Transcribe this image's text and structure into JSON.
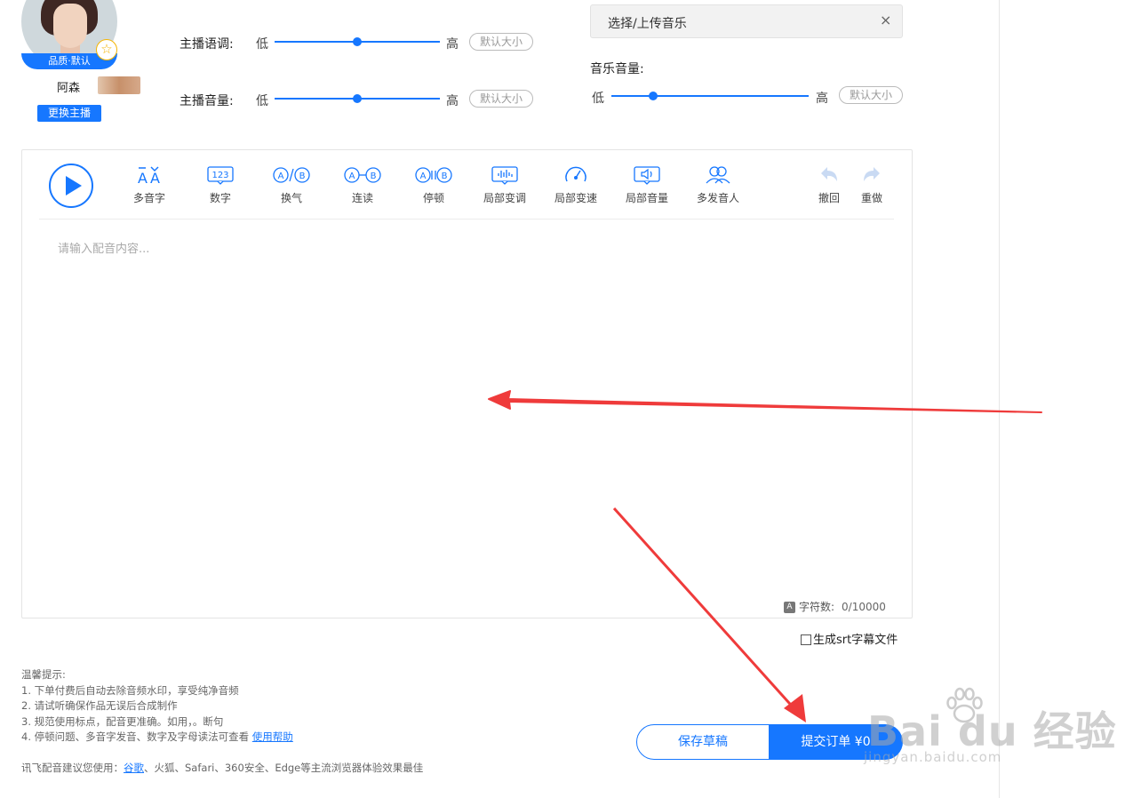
{
  "anchor": {
    "quality_badge": "品质·默认",
    "name": "阿森",
    "change_label": "更换主播"
  },
  "sliders": {
    "tone": {
      "label": "主播语调:",
      "low": "低",
      "high": "高",
      "default_label": "默认大小",
      "level": 0.5
    },
    "volume": {
      "label": "主播音量:",
      "low": "低",
      "high": "高",
      "default_label": "默认大小",
      "level": 0.5
    },
    "music": {
      "label": "音乐音量:",
      "low": "低",
      "high": "高",
      "default_label": "默认大小",
      "level": 0.2
    }
  },
  "music": {
    "select_label": "选择/上传音乐",
    "close_icon": "×"
  },
  "toolbar": {
    "items": [
      {
        "label": "多音字",
        "icon": "polyphone-icon"
      },
      {
        "label": "数字",
        "icon": "number-icon",
        "icon_text": "123"
      },
      {
        "label": "换气",
        "icon": "breath-icon"
      },
      {
        "label": "连读",
        "icon": "liaison-icon"
      },
      {
        "label": "停顿",
        "icon": "pause-icon"
      },
      {
        "label": "局部变调",
        "icon": "pitch-icon"
      },
      {
        "label": "局部变速",
        "icon": "speed-icon"
      },
      {
        "label": "局部音量",
        "icon": "volume-icon"
      },
      {
        "label": "多发音人",
        "icon": "multi-speaker-icon"
      }
    ],
    "undo_label": "撤回",
    "redo_label": "重做"
  },
  "editor": {
    "placeholder": "请输入配音内容...",
    "char_label": "字符数:",
    "char_count": "0/10000"
  },
  "srt_label": "生成srt字幕文件",
  "tips": {
    "title": "温馨提示:",
    "lines": [
      "1. 下单付费后自动去除音频水印，享受纯净音频",
      "2. 请试听确保作品无误后合成制作",
      "3. 规范使用标点，配音更准确。如用，。断句",
      "4. 停顿问题、多音字发音、数字及字母读法可查看"
    ],
    "help_link": "使用帮助"
  },
  "browser": {
    "prefix": "讯飞配音建议您使用：",
    "chrome_link": "谷歌",
    "suffix": "、火狐、Safari、360安全、Edge等主流浏览器体验效果最佳"
  },
  "actions": {
    "save_label": "保存草稿",
    "submit_label": "提交订单 ¥0"
  },
  "watermark": {
    "main": "Bai du 经验",
    "sub": "jingyan.baidu.com"
  },
  "colors": {
    "accent": "#1677ff",
    "arrow": "#ef3b3b"
  }
}
